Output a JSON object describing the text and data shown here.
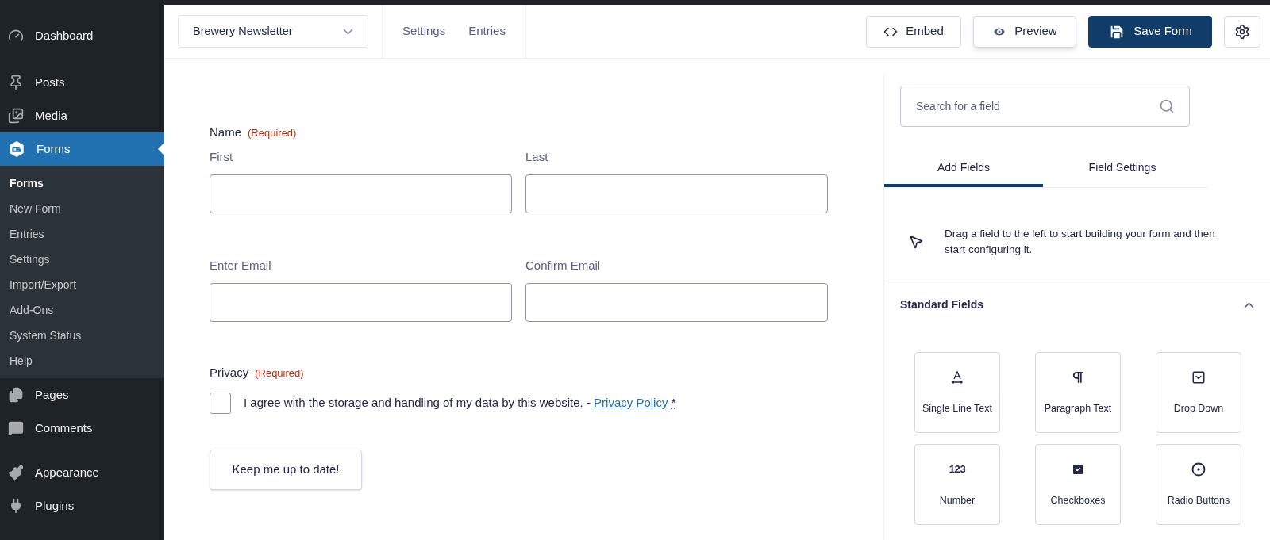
{
  "sidebar": {
    "items": [
      {
        "label": "Dashboard",
        "selected": false
      },
      {
        "label": "Posts",
        "selected": false
      },
      {
        "label": "Media",
        "selected": false
      },
      {
        "label": "Forms",
        "selected": true,
        "children": [
          {
            "label": "Forms",
            "selected": true
          },
          {
            "label": "New Form",
            "selected": false
          },
          {
            "label": "Entries",
            "selected": false
          },
          {
            "label": "Settings",
            "selected": false
          },
          {
            "label": "Import/Export",
            "selected": false
          },
          {
            "label": "Add-Ons",
            "selected": false
          },
          {
            "label": "System Status",
            "selected": false
          },
          {
            "label": "Help",
            "selected": false
          }
        ]
      },
      {
        "label": "Pages",
        "selected": false
      },
      {
        "label": "Comments",
        "selected": false
      },
      {
        "label": "Appearance",
        "selected": false
      },
      {
        "label": "Plugins",
        "selected": false
      }
    ]
  },
  "toolbar": {
    "form_select": "Brewery Newsletter",
    "links": [
      "Settings",
      "Entries"
    ],
    "buttons": [
      {
        "label": "Embed",
        "kind": "embed"
      },
      {
        "label": "Preview",
        "kind": "preview"
      },
      {
        "label": "Save Form",
        "kind": "save"
      }
    ]
  },
  "form": {
    "name_field": {
      "label": "Name",
      "required": "(Required)",
      "subfields": [
        "First",
        "Last"
      ]
    },
    "email_field": {
      "subfields": [
        "Enter Email",
        "Confirm Email"
      ]
    },
    "privacy_field": {
      "label": "Privacy",
      "required": "(Required)",
      "checked": false,
      "text": "I agree with the storage and handling of my data by this website. -",
      "link": "Privacy Policy",
      "mark": "*"
    },
    "submit": "Keep me up to date!"
  },
  "panel": {
    "search": {
      "placeholder": "Search for a field"
    },
    "tabs": [
      {
        "label": "Add Fields",
        "selected": true
      },
      {
        "label": "Field Settings",
        "selected": false
      }
    ],
    "hint": "Drag a field to the left to start building your form and then start configuring it.",
    "section": {
      "title": "Standard Fields",
      "expanded": true,
      "fields": [
        {
          "label": "Single Line Text",
          "kind": "text"
        },
        {
          "label": "Paragraph Text",
          "kind": "paragraph"
        },
        {
          "label": "Drop Down",
          "kind": "select"
        },
        {
          "label": "Number",
          "kind": "number",
          "glyph": "123"
        },
        {
          "label": "Checkboxes",
          "kind": "checkbox"
        },
        {
          "label": "Radio Buttons",
          "kind": "radio"
        }
      ]
    }
  }
}
